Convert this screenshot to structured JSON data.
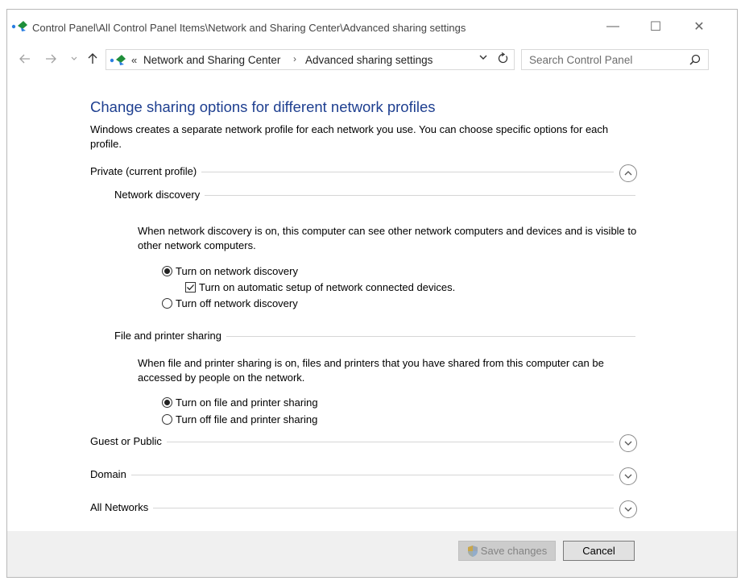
{
  "window": {
    "title": "Control Panel\\All Control Panel Items\\Network and Sharing Center\\Advanced sharing settings",
    "minimize_glyph": "—",
    "maximize_glyph": "☐",
    "close_glyph": "✕"
  },
  "address": {
    "breadcrumb_prefix": "«",
    "crumbs": [
      "Network and Sharing Center",
      "Advanced sharing settings"
    ],
    "separator": "›",
    "search_placeholder": "Search Control Panel"
  },
  "page": {
    "title": "Change sharing options for different network profiles",
    "description": "Windows creates a separate network profile for each network you use. You can choose specific options for each profile."
  },
  "profiles": {
    "private": {
      "label": "Private (current profile)",
      "expanded": true,
      "network_discovery": {
        "label": "Network discovery",
        "description": "When network discovery is on, this computer can see other network computers and devices and is visible to other network computers.",
        "on_label": "Turn on network discovery",
        "auto_setup_label": "Turn on automatic setup of network connected devices.",
        "off_label": "Turn off network discovery",
        "selected": "on",
        "auto_setup_checked": true
      },
      "file_sharing": {
        "label": "File and printer sharing",
        "description": "When file and printer sharing is on, files and printers that you have shared from this computer can be accessed by people on the network.",
        "on_label": "Turn on file and printer sharing",
        "off_label": "Turn off file and printer sharing",
        "selected": "on"
      }
    },
    "guest": {
      "label": "Guest or Public",
      "expanded": false
    },
    "domain": {
      "label": "Domain",
      "expanded": false
    },
    "all": {
      "label": "All Networks",
      "expanded": false
    }
  },
  "footer": {
    "save_label": "Save changes",
    "save_enabled": false,
    "cancel_label": "Cancel"
  },
  "colors": {
    "title_blue": "#1e3f90",
    "footer_bg": "#f0f0f0",
    "divider": "#d6d6d6"
  },
  "icons": [
    "network-center-icon",
    "back-arrow-icon",
    "forward-arrow-icon",
    "recent-dropdown-icon",
    "up-arrow-icon",
    "dropdown-chevron-icon",
    "refresh-icon",
    "search-icon",
    "chevron-up-icon",
    "chevron-down-icon",
    "checkmark-icon",
    "uac-shield-icon"
  ]
}
